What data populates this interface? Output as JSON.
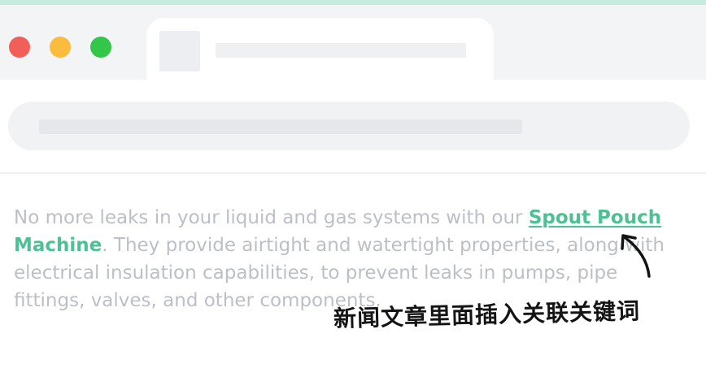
{
  "browser": {
    "window_controls": [
      "close",
      "minimize",
      "maximize"
    ],
    "colors": {
      "accent_strip": "#c6ece0",
      "close": "#f25f58",
      "minimize": "#fbbc3d",
      "maximize": "#32c748"
    }
  },
  "article": {
    "text_before": "No more leaks in your liquid and gas systems with our ",
    "link_text": "Spout Pouch",
    "keyword_text": "Machine",
    "text_after": ". They provide airtight and watertight properties, along with electrical insulation capabilities, to prevent leaks in pumps, pipe fittings, valves, and other components.",
    "keyword_color": "#4dc193",
    "text_color": "#bcc0c6"
  },
  "annotation": {
    "text": "新闻文章里面插入关联关键词",
    "arrow_icon": "curved-arrow-up-icon"
  }
}
